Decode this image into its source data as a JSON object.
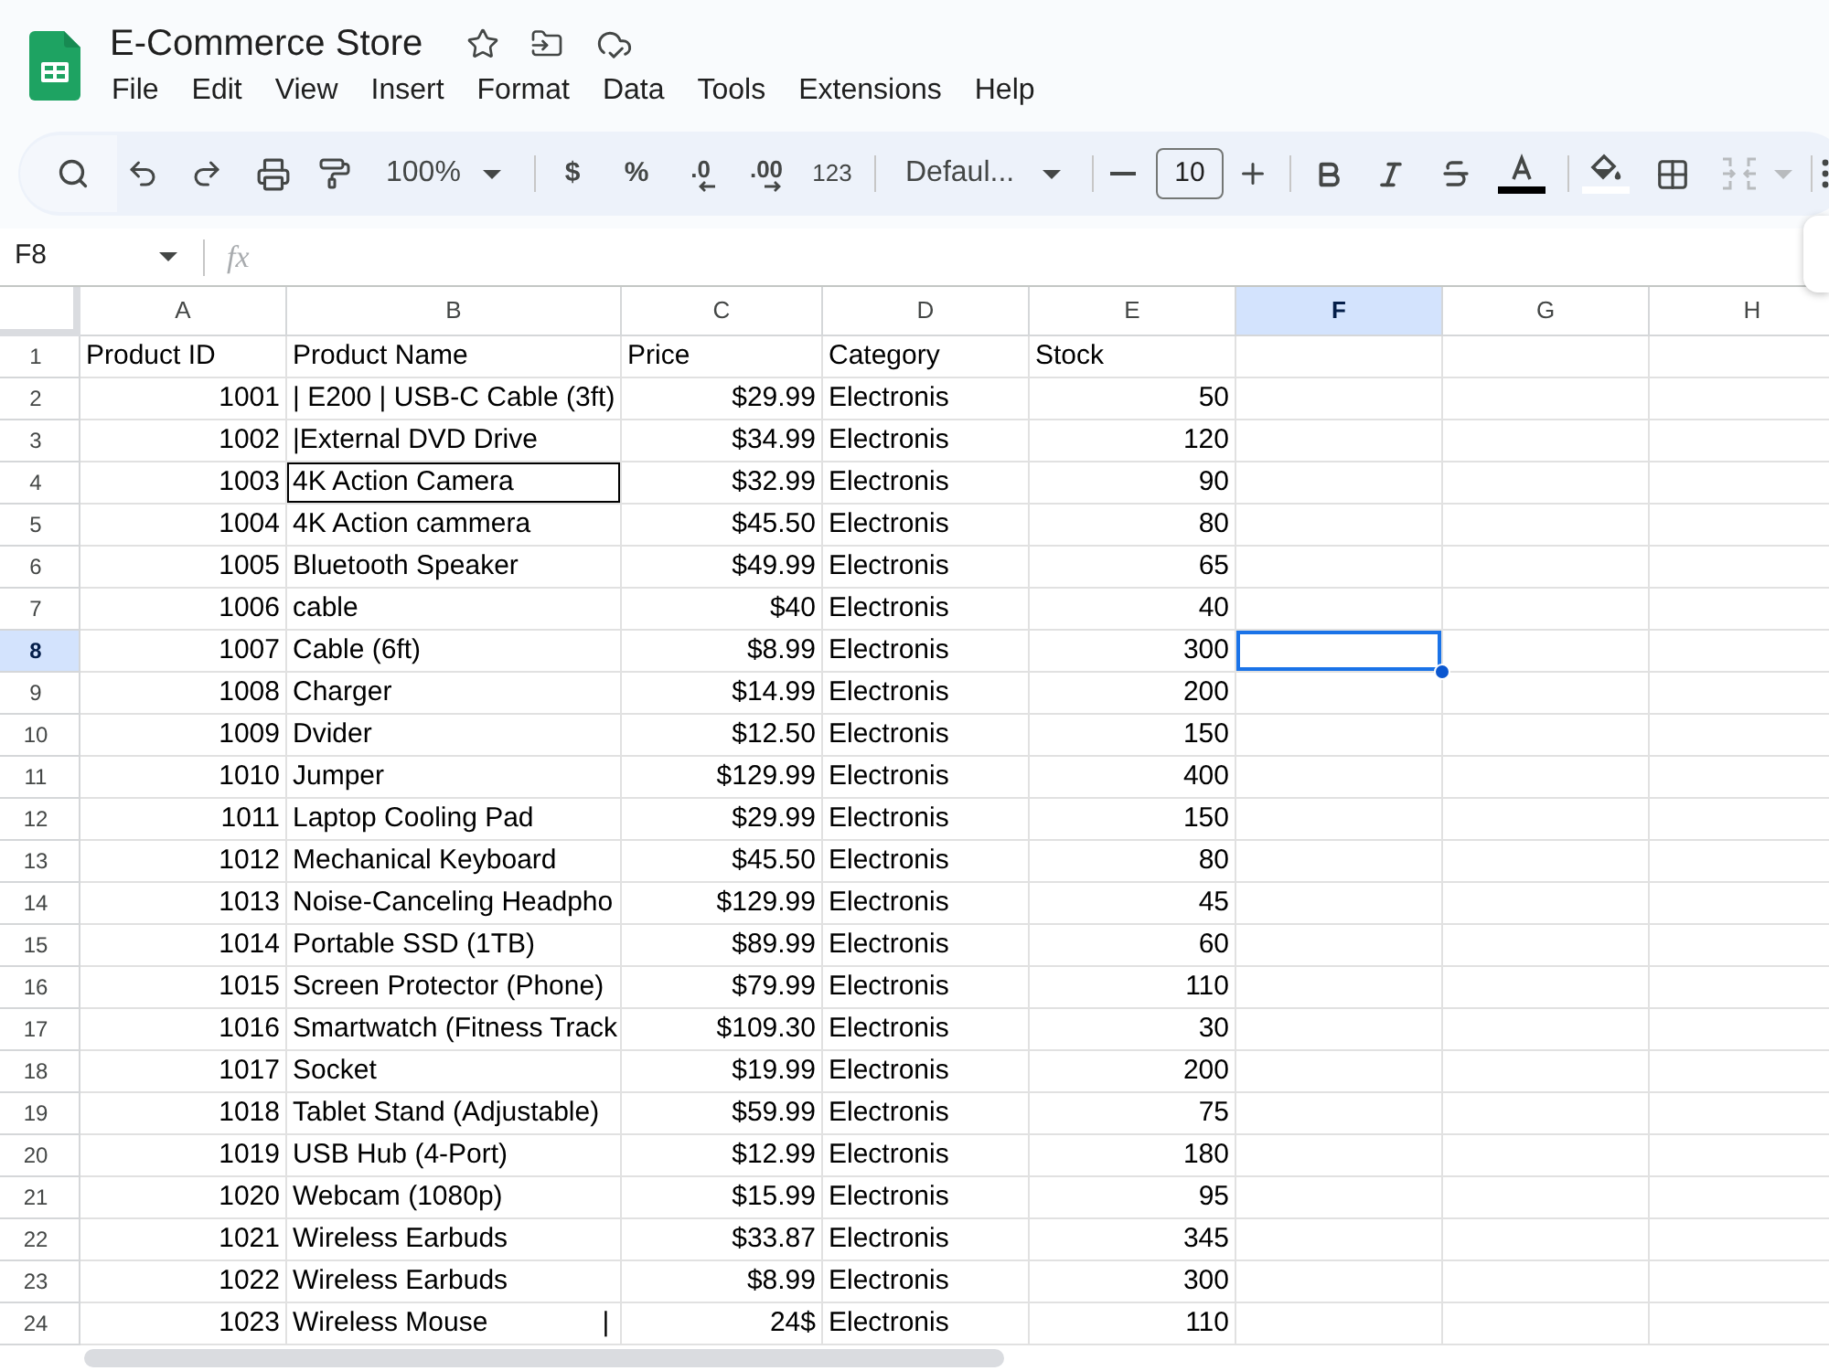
{
  "document": {
    "title": "E-Commerce Store"
  },
  "menu": [
    "File",
    "Edit",
    "View",
    "Insert",
    "Format",
    "Data",
    "Tools",
    "Extensions",
    "Help"
  ],
  "toolbar": {
    "zoom": "100%",
    "currency": "$",
    "percent": "%",
    "decrease_decimal": ".0",
    "increase_decimal": ".00",
    "number_format": "123",
    "font": "Defaul...",
    "font_size": "10",
    "merge": {
      "disabled": true
    }
  },
  "formula_bar": {
    "cell_reference": "F8",
    "function_label": "fx"
  },
  "columns": [
    {
      "label": "A",
      "selected": false
    },
    {
      "label": "B",
      "selected": false
    },
    {
      "label": "C",
      "selected": false
    },
    {
      "label": "D",
      "selected": false
    },
    {
      "label": "E",
      "selected": false
    },
    {
      "label": "F",
      "selected": true
    },
    {
      "label": "G",
      "selected": false
    },
    {
      "label": "H",
      "selected": false
    }
  ],
  "rows": [
    {
      "number": "1",
      "selected": false,
      "cells": [
        "Product ID",
        "Product Name",
        "Price",
        "Category",
        "Stock"
      ]
    },
    {
      "number": "2",
      "selected": false,
      "cells": [
        "1001",
        "| E200 | USB-C Cable (3ft)",
        "$29.99",
        "Electronis",
        "50"
      ]
    },
    {
      "number": "3",
      "selected": false,
      "cells": [
        "1002",
        "|External DVD Drive",
        "$34.99",
        "Electronis",
        "120"
      ]
    },
    {
      "number": "4",
      "selected": false,
      "cells": [
        "1003",
        {
          "text": "4K Action Camera",
          "outlined": true
        },
        "$32.99",
        "Electronis",
        "90"
      ]
    },
    {
      "number": "5",
      "selected": false,
      "cells": [
        "1004",
        "4K Action cammera",
        "$45.50",
        "Electronis",
        "80"
      ]
    },
    {
      "number": "6",
      "selected": false,
      "cells": [
        "1005",
        "Bluetooth Speaker",
        "$49.99",
        "Electronis",
        "65"
      ]
    },
    {
      "number": "7",
      "selected": false,
      "cells": [
        "1006",
        "cable",
        "$40",
        "Electronis",
        "40"
      ]
    },
    {
      "number": "8",
      "selected": true,
      "cells": [
        "1007",
        "Cable (6ft)",
        "$8.99",
        "Electronis",
        "300"
      ]
    },
    {
      "number": "9",
      "selected": false,
      "cells": [
        "1008",
        "Charger",
        "$14.99",
        "Electronis",
        "200"
      ]
    },
    {
      "number": "10",
      "selected": false,
      "cells": [
        "1009",
        "Dvider",
        "$12.50",
        "Electronis",
        "150"
      ]
    },
    {
      "number": "11",
      "selected": false,
      "cells": [
        "1010",
        "Jumper",
        "$129.99",
        "Electronis",
        "400"
      ]
    },
    {
      "number": "12",
      "selected": false,
      "cells": [
        "1011",
        "Laptop Cooling Pad",
        "$29.99",
        "Electronis",
        "150"
      ]
    },
    {
      "number": "13",
      "selected": false,
      "cells": [
        "1012",
        "Mechanical Keyboard",
        "$45.50",
        "Electronis",
        "80"
      ]
    },
    {
      "number": "14",
      "selected": false,
      "cells": [
        "1013",
        "Noise-Canceling Headpho",
        "$129.99",
        "Electronis",
        "45"
      ]
    },
    {
      "number": "15",
      "selected": false,
      "cells": [
        "1014",
        "Portable SSD (1TB)",
        "$89.99",
        "Electronis",
        "60"
      ]
    },
    {
      "number": "16",
      "selected": false,
      "cells": [
        "1015",
        "Screen Protector (Phone)",
        "$79.99",
        "Electronis",
        "110"
      ]
    },
    {
      "number": "17",
      "selected": false,
      "cells": [
        "1016",
        "Smartwatch (Fitness Track",
        "$109.30",
        "Electronis",
        "30"
      ]
    },
    {
      "number": "18",
      "selected": false,
      "cells": [
        "1017",
        "Socket",
        "$19.99",
        "Electronis",
        "200"
      ]
    },
    {
      "number": "19",
      "selected": false,
      "cells": [
        "1018",
        "Tablet Stand (Adjustable)",
        "$59.99",
        "Electronis",
        "75"
      ]
    },
    {
      "number": "20",
      "selected": false,
      "cells": [
        "1019",
        "USB Hub (4-Port)",
        "$12.99",
        "Electronis",
        "180"
      ]
    },
    {
      "number": "21",
      "selected": false,
      "cells": [
        "1020",
        "Webcam (1080p)",
        "$15.99",
        "Electronis",
        "95"
      ]
    },
    {
      "number": "22",
      "selected": false,
      "cells": [
        "1021",
        "Wireless Earbuds",
        "$33.87",
        "Electronis",
        "345"
      ]
    },
    {
      "number": "23",
      "selected": false,
      "cells": [
        "1022",
        "Wireless Earbuds",
        "$8.99",
        "Electronis",
        "300"
      ]
    },
    {
      "number": "24",
      "selected": false,
      "cells": [
        "1023",
        "Wireless Mouse               |",
        "24$",
        "Electronis",
        "110"
      ]
    }
  ]
}
